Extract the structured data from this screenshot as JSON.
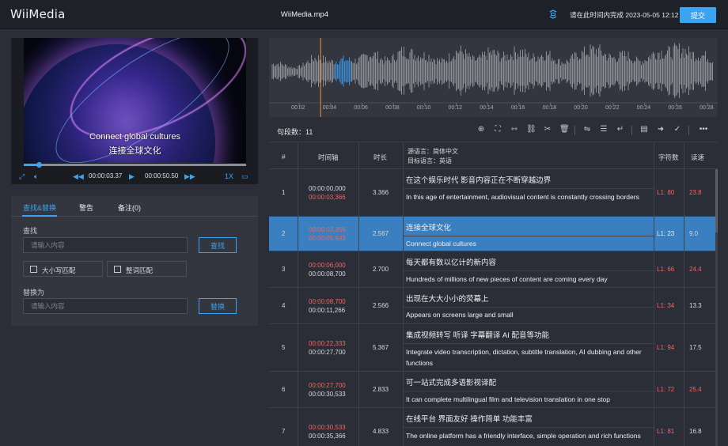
{
  "header": {
    "logo": "WiiMedia",
    "filename": "WiiMedia.mp4",
    "deadline": "请在此时间内完成 2023-05-05 12:12",
    "submit_label": "提交"
  },
  "player": {
    "subtitle_en": "Connect global cultures",
    "subtitle_zh": "连接全球文化",
    "current_time": "00:00:03.37",
    "total_time": "00:00:50.50",
    "progress": 0.067,
    "speed": "1X"
  },
  "search": {
    "tabs": [
      "查找&替换",
      "警告",
      "备注(0)"
    ],
    "find_label": "查找",
    "find_placeholder": "请输入内容",
    "find_button": "查找",
    "case_label": "大小写匹配",
    "word_label": "整词匹配",
    "replace_label": "替换为",
    "replace_placeholder": "请输入内容",
    "replace_button": "替换"
  },
  "waveform": {
    "ticks": [
      "00:02",
      "00:04",
      "00:06",
      "00:08",
      "00:10",
      "00:12",
      "00:14",
      "00:16",
      "00:18",
      "00:20",
      "00:22",
      "00:24",
      "00:26",
      "00:28"
    ],
    "playhead": "00:03.37"
  },
  "segments": {
    "count_label": "句段数：11"
  },
  "table": {
    "headers": {
      "index": "#",
      "timeline": "时间轴",
      "duration": "时长",
      "lang_src": "源语言：简体中文",
      "lang_tgt": "目标语言：英语",
      "chars": "字符数",
      "speed": "读速"
    },
    "rows": [
      {
        "index": "1",
        "start": "00:00:00,000",
        "end": "00:00:03,366",
        "duration": "3.366",
        "source": "在这个娱乐时代 影音内容正在不断穿越边界",
        "target": "In this age of entertainment, audiovisual content is constantly crossing borders",
        "chars": "L1: 80",
        "speed": "23.8",
        "selected": false
      },
      {
        "index": "2",
        "start": "00:00:03,366",
        "end": "00:00:05,933",
        "duration": "2.567",
        "source": "连接全球文化",
        "target": "Connect global cultures",
        "chars": "L1: 23",
        "speed": "9.0",
        "selected": true
      },
      {
        "index": "3",
        "start": "00:00:06,000",
        "end": "00:00:08,700",
        "duration": "2.700",
        "source": "每天都有数以亿计的新内容",
        "target": "Hundreds of millions of new pieces of content are coming every day",
        "chars": "L1: 66",
        "speed": "24.4",
        "selected": false
      },
      {
        "index": "4",
        "start": "00:00:08,700",
        "end": "00:00:11,266",
        "duration": "2.566",
        "source": "出现在大大小小的荧幕上",
        "target": "Appears on screens large and small",
        "chars": "L1: 34",
        "speed": "13.3",
        "selected": false
      },
      {
        "index": "5",
        "start": "00:00:22,333",
        "end": "00:00:27,700",
        "duration": "5.367",
        "source": "集成视频转写 听译 字幕翻译 AI 配音等功能",
        "target": "Integrate video transcription, dictation, subtitle translation, AI dubbing and other functions",
        "chars": "L1: 94",
        "speed": "17.5",
        "selected": false
      },
      {
        "index": "6",
        "start": "00:00:27,700",
        "end": "00:00:30,533",
        "duration": "2.833",
        "source": "可一站式完成多语影视译配",
        "target": "It can complete multilingual film and television translation in one stop",
        "chars": "L1: 72",
        "speed": "25.4",
        "selected": false
      },
      {
        "index": "7",
        "start": "00:00:30,533",
        "end": "00:00:35,366",
        "duration": "4.833",
        "source": "在线平台 界面友好 操作简单 功能丰富",
        "target": "The online platform has a friendly interface, simple operation and rich functions",
        "chars": "L1: 81",
        "speed": "16.8",
        "selected": false
      }
    ]
  },
  "colors": {
    "accent": "#3aa4f0",
    "selected_row": "#3a7fc0",
    "warning": "#f26565"
  }
}
